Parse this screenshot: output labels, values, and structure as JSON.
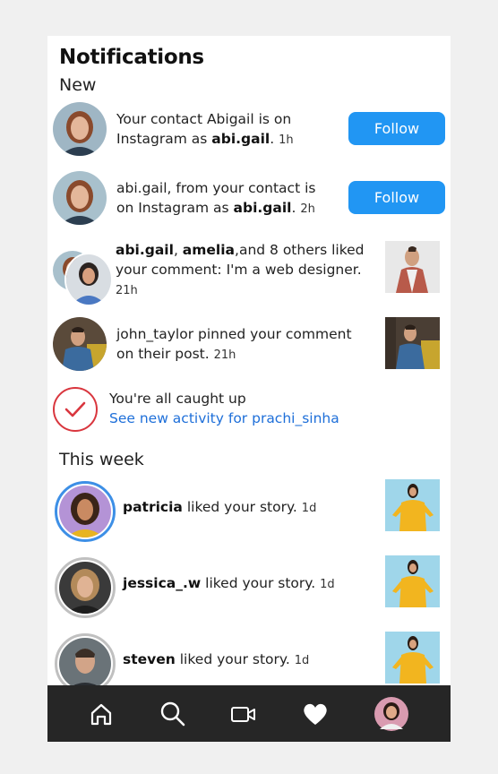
{
  "header": {
    "title": "Notifications",
    "section_new": "New",
    "section_week": "This week"
  },
  "notifications_new": [
    {
      "pre": "Your contact Abigail is on Instagram as ",
      "bold": "abi.gail",
      "post": ".",
      "time": "1h",
      "button": "Follow"
    },
    {
      "pre": "abi.gail, from your contact is on Instagram as ",
      "bold": "abi.gail",
      "post": "",
      "time": "2h",
      "button": "Follow"
    },
    {
      "bold1": "abi.gail",
      "sep": ", ",
      "bold2": "amelia",
      "post": ",and 8 others liked your comment: I'm a web designer.",
      "time": "21h"
    },
    {
      "text": "john_taylor pinned your comment on their post.",
      "time": "21h"
    }
  ],
  "caught_up": {
    "title": "You're all caught up",
    "link": "See new activity for prachi_sinha"
  },
  "notifications_week": [
    {
      "user": "patricia",
      "action": "liked your story.",
      "time": "1d"
    },
    {
      "user": "jessica_.w",
      "action": "liked your story.",
      "time": "1d"
    },
    {
      "user": "steven",
      "action": "liked your story.",
      "time": "1d"
    }
  ],
  "nav": {
    "items": [
      "home-icon",
      "search-icon",
      "video-icon",
      "heart-icon",
      "profile-avatar"
    ]
  },
  "colors": {
    "accent": "#2196f3",
    "link": "#1e6fd9",
    "check": "#d9363e",
    "nav_bg": "#262626",
    "ring_active": "#3d8fe6",
    "ring_inactive": "#c0c0c0"
  }
}
